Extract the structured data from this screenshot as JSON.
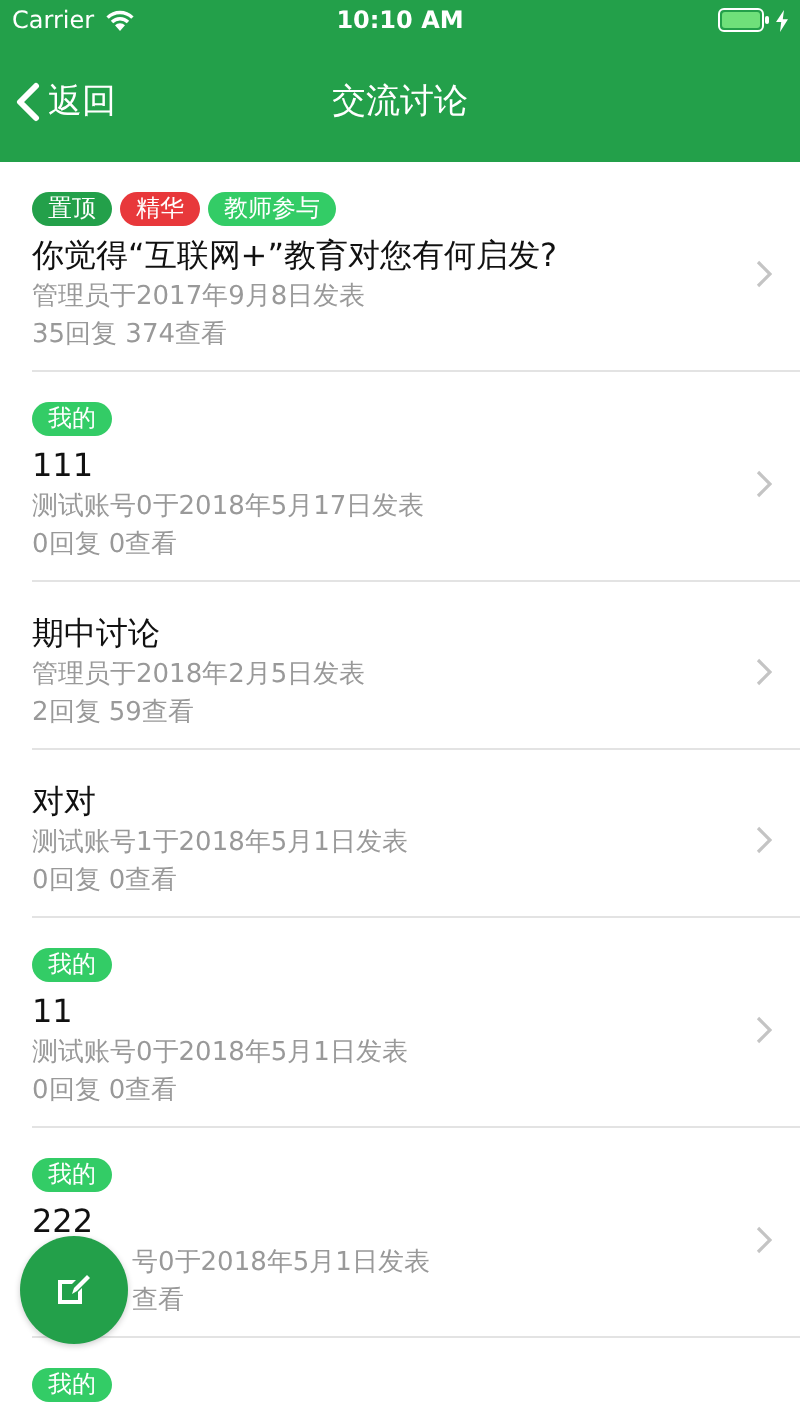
{
  "status_bar": {
    "carrier": "Carrier",
    "time": "10:10 AM"
  },
  "nav_bar": {
    "back": "返回",
    "title": "交流讨论"
  },
  "topics": [
    {
      "tags": [
        {
          "label": "置顶",
          "color": "#23a04a"
        },
        {
          "label": "精华",
          "color": "#e8383b"
        },
        {
          "label": "教师参与",
          "color": "#33cc66"
        }
      ],
      "title": "你觉得“互联网+”教育对您有何启发?",
      "meta": "管理员于2017年9月8日发表",
      "stats": "35回复 374查看",
      "covered": false
    },
    {
      "tags": [
        {
          "label": "我的",
          "color": "#33cc66"
        }
      ],
      "title": "111",
      "meta": "测试账号0于2018年5月17日发表",
      "stats": "0回复 0查看",
      "covered": false
    },
    {
      "title": "期中讨论",
      "meta": "管理员于2018年2月5日发表",
      "stats": "2回复 59查看",
      "covered": false
    },
    {
      "title": "对对",
      "meta": "测试账号1于2018年5月1日发表",
      "stats": "0回复 0查看",
      "covered": false
    },
    {
      "tags": [
        {
          "label": "我的",
          "color": "#33cc66"
        }
      ],
      "title": "11",
      "meta": "测试账号0于2018年5月1日发表",
      "stats": "0回复 0查看",
      "covered": false
    },
    {
      "tags": [
        {
          "label": "我的",
          "color": "#33cc66"
        }
      ],
      "title": "222",
      "meta": "号0于2018年5月1日发表",
      "stats": "查看",
      "covered": true
    },
    {
      "tags": [
        {
          "label": "我的",
          "color": "#33cc66"
        }
      ]
    }
  ]
}
